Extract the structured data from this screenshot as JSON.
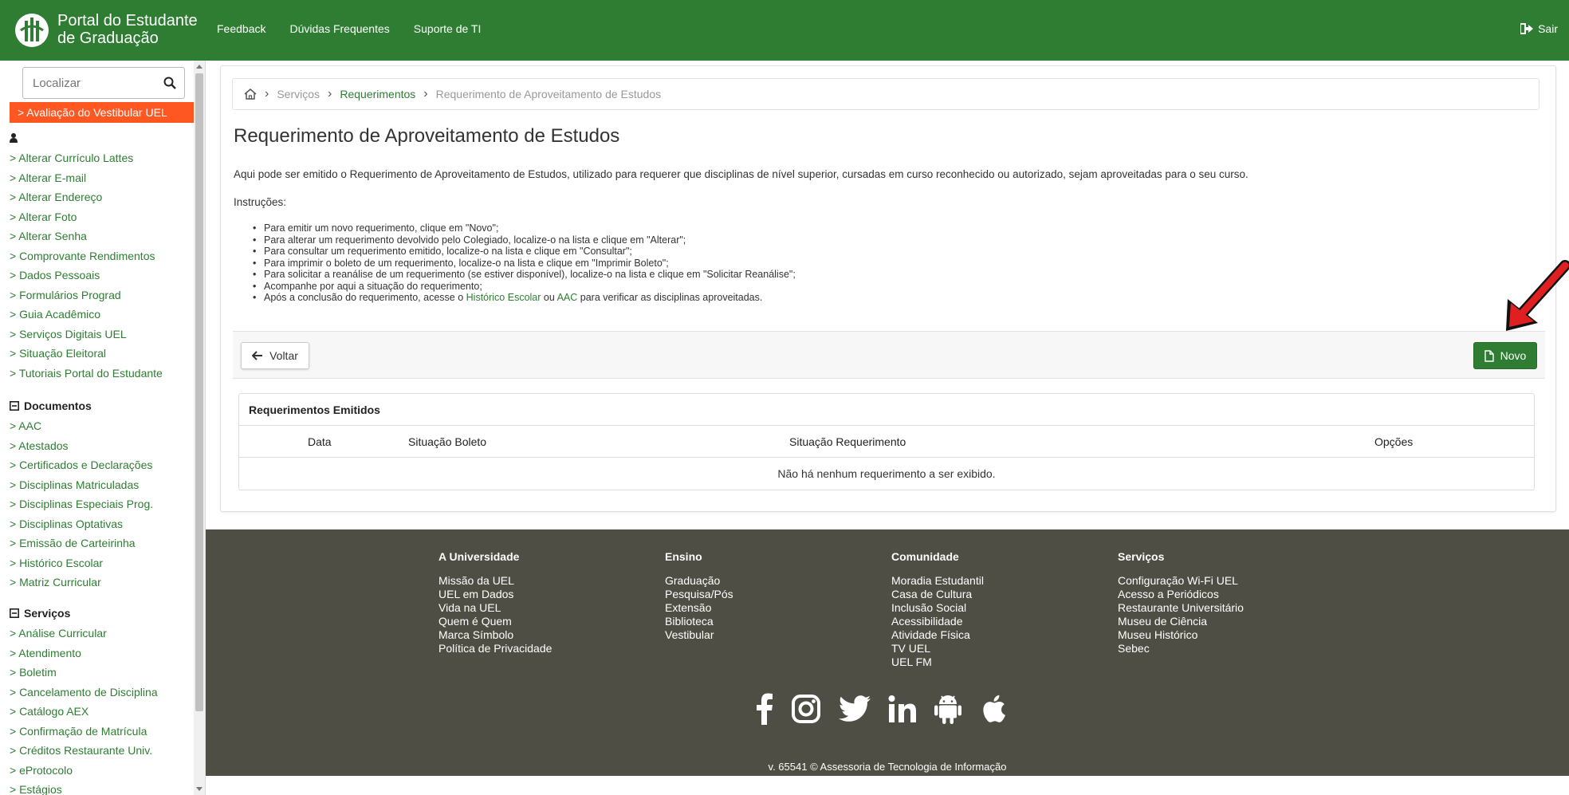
{
  "header": {
    "brand_line1": "Portal do Estudante",
    "brand_line2": "de Graduação",
    "nav": [
      "Feedback",
      "Dúvidas Frequentes",
      "Suporte de TI"
    ],
    "logout_label": "Sair",
    "color": "#2e7d32"
  },
  "sidebar": {
    "search_placeholder": "Localizar",
    "promo": "> Avaliação do Vestibular UEL",
    "user_items": [
      "> Alterar Currículo Lattes",
      "> Alterar E-mail",
      "> Alterar Endereço",
      "> Alterar Foto",
      "> Alterar Senha",
      "> Comprovante Rendimentos",
      "> Dados Pessoais",
      "> Formulários Prograd",
      "> Guia Acadêmico",
      "> Serviços Digitais UEL",
      "> Situação Eleitoral",
      "> Tutoriais Portal do Estudante"
    ],
    "documentos_title": "Documentos",
    "documentos_items": [
      "> AAC",
      "> Atestados",
      "> Certificados e Declarações",
      "> Disciplinas Matriculadas",
      "> Disciplinas Especiais Prog.",
      "> Disciplinas Optativas",
      "> Emissão de Carteirinha",
      "> Histórico Escolar",
      "> Matriz Curricular"
    ],
    "servicos_title": "Serviços",
    "servicos_items": [
      "> Análise Curricular",
      "> Atendimento",
      "> Boletim",
      "> Cancelamento de Disciplina",
      "> Catálogo AEX",
      "> Confirmação de Matrícula",
      "> Créditos Restaurante Univ.",
      "> eProtocolo",
      "> Estágios"
    ]
  },
  "main": {
    "breadcrumb": [
      "Serviços",
      "Requerimentos",
      "Requerimento de Aproveitamento de Estudos"
    ],
    "title": "Requerimento de Aproveitamento de Estudos",
    "intro": "Aqui pode ser emitido o Requerimento de Aproveitamento de Estudos, utilizado para requerer que disciplinas de nível superior, cursadas em curso reconhecido ou autorizado, sejam aproveitadas para o seu curso.",
    "instructions_title": "Instruções:",
    "instructions": [
      "Para emitir um novo requerimento, clique em \"Novo\";",
      "Para alterar um requerimento devolvido pelo Colegiado, localize-o na lista e clique em \"Alterar\";",
      "Para consultar um requerimento emitido, localize-o na lista e clique em \"Consultar\";",
      "Para imprimir o boleto de um requerimento, localize-o na lista e clique em \"Imprimir Boleto\";",
      "Para solicitar a reanálise de um requerimento (se estiver disponível), localize-o na lista e clique em \"Solicitar Reanálise\";",
      "Acompanhe por aqui a situação do requerimento;"
    ],
    "last_instruction": {
      "prefix": "Após a conclusão do requerimento, acesse o ",
      "link1": "Histórico Escolar",
      "middle": " ou ",
      "link2": "AAC",
      "suffix": " para verificar as disciplinas aproveitadas."
    },
    "back_label": "Voltar",
    "new_label": "Novo",
    "panel_title": "Requerimentos Emitidos",
    "columns": [
      "Data",
      "Situação Boleto",
      "Situação Requerimento",
      "Opções"
    ],
    "empty_message": "Não há nenhum requerimento a ser exibido."
  },
  "footer": {
    "columns": [
      {
        "title": "A Universidade",
        "items": [
          "Missão da UEL",
          "UEL em Dados",
          "Vida na UEL",
          "Quem é Quem",
          "Marca Símbolo",
          "Política de Privacidade"
        ]
      },
      {
        "title": "Ensino",
        "items": [
          "Graduação",
          "Pesquisa/Pós",
          "Extensão",
          "Biblioteca",
          "Vestibular"
        ]
      },
      {
        "title": "Comunidade",
        "items": [
          "Moradia Estudantil",
          "Casa de Cultura",
          "Inclusão Social",
          "Acessibilidade",
          "Atividade Física",
          "TV UEL",
          "UEL FM"
        ]
      },
      {
        "title": "Serviços",
        "items": [
          "Configuração Wi-Fi UEL",
          "Acesso a Periódicos",
          "Restaurante Universitário",
          "Museu de Ciência",
          "Museu Histórico",
          "Sebec"
        ]
      }
    ],
    "social_icons": [
      "facebook-icon",
      "instagram-icon",
      "twitter-icon",
      "linkedin-icon",
      "android-icon",
      "apple-icon"
    ],
    "copyright": "v. 65541 © Assessoria de Tecnologia de Informação",
    "background": "#4e4e45"
  }
}
